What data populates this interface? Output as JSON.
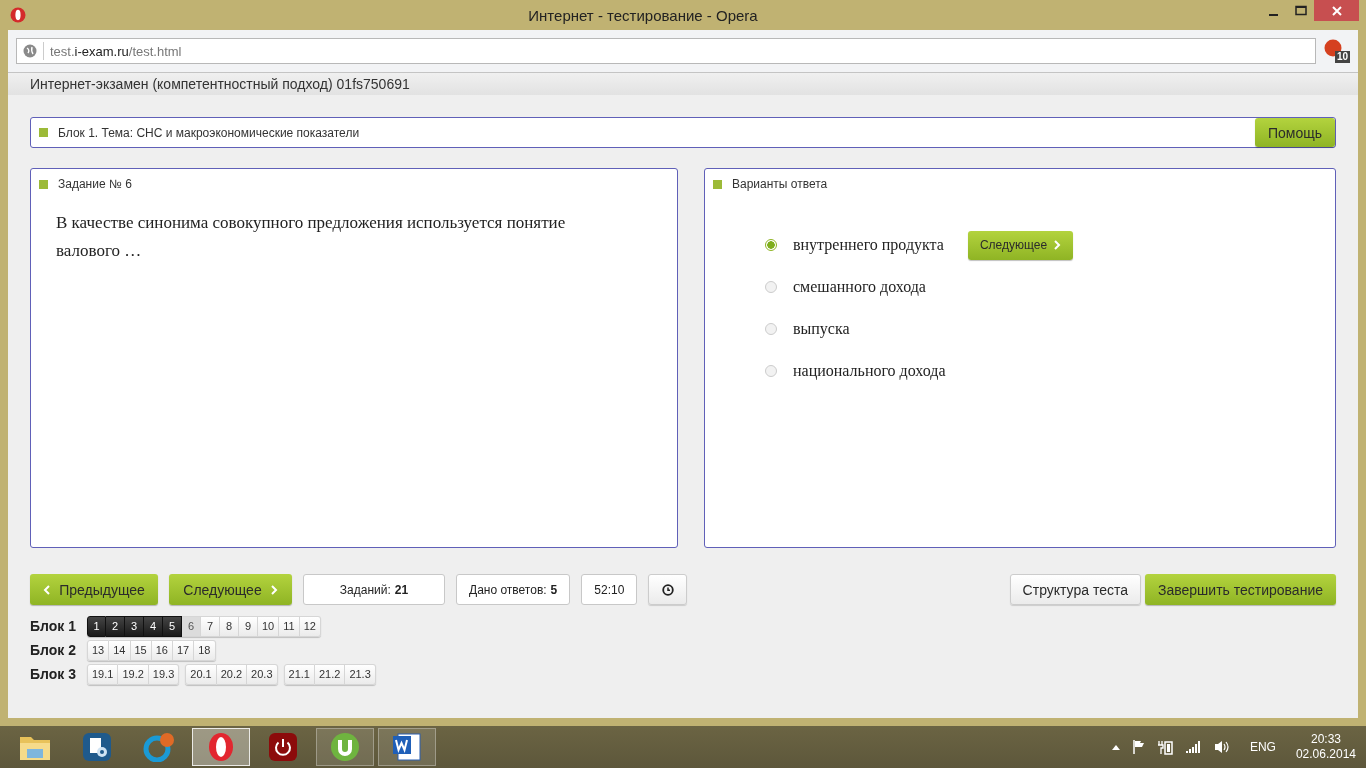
{
  "window": {
    "title": "Интернет - тестирование - Opera"
  },
  "address_bar": {
    "url": {
      "subdomain": "test.",
      "domain": "i-exam.ru",
      "path": "/test.html"
    },
    "extension_badge": "10"
  },
  "page_header": {
    "title": "Интернет-экзамен (компетентностный подход) 01fs750691"
  },
  "block_bar": {
    "title": "Блок 1. Тема: СНС и макроэкономические показатели",
    "help_button": "Помощь"
  },
  "task_panel": {
    "title": "Задание № 6",
    "question": "В качестве синонима совокупного предложения используется понятие валового …"
  },
  "answers_panel": {
    "title": "Варианты ответа",
    "next_button": "Следующее",
    "options": [
      {
        "label": "внутреннего продукта",
        "selected": true
      },
      {
        "label": "смешанного дохода",
        "selected": false
      },
      {
        "label": "выпуска",
        "selected": false
      },
      {
        "label": "национального дохода",
        "selected": false
      }
    ]
  },
  "nav": {
    "prev_button": "Предыдущее",
    "next_button": "Следующее",
    "counters": [
      {
        "label": "Заданий:",
        "value": "21"
      },
      {
        "label": "Дано ответов:",
        "value": "5"
      }
    ],
    "timer": "52:10",
    "structure_button": "Структура теста",
    "finish_button": "Завершить тестирование"
  },
  "blocks": [
    {
      "name": "Блок 1",
      "groups": [
        [
          {
            "label": "1",
            "answered": true,
            "selected": false
          },
          {
            "label": "2",
            "answered": true,
            "selected": false
          },
          {
            "label": "3",
            "answered": true,
            "selected": false
          },
          {
            "label": "4",
            "answered": true,
            "selected": false
          },
          {
            "label": "5",
            "answered": true,
            "selected": false
          },
          {
            "label": "6",
            "answered": false,
            "selected": true
          },
          {
            "label": "7",
            "answered": false,
            "selected": false
          },
          {
            "label": "8",
            "answered": false,
            "selected": false
          },
          {
            "label": "9",
            "answered": false,
            "selected": false
          },
          {
            "label": "10",
            "answered": false,
            "selected": false
          },
          {
            "label": "11",
            "answered": false,
            "selected": false
          },
          {
            "label": "12",
            "answered": false,
            "selected": false
          }
        ]
      ]
    },
    {
      "name": "Блок 2",
      "groups": [
        [
          {
            "label": "13",
            "answered": false,
            "selected": false
          },
          {
            "label": "14",
            "answered": false,
            "selected": false
          },
          {
            "label": "15",
            "answered": false,
            "selected": false
          },
          {
            "label": "16",
            "answered": false,
            "selected": false
          },
          {
            "label": "17",
            "answered": false,
            "selected": false
          },
          {
            "label": "18",
            "answered": false,
            "selected": false
          }
        ]
      ]
    },
    {
      "name": "Блок 3",
      "groups": [
        [
          {
            "label": "19.1",
            "answered": false,
            "selected": false
          },
          {
            "label": "19.2",
            "answered": false,
            "selected": false
          },
          {
            "label": "19.3",
            "answered": false,
            "selected": false
          }
        ],
        [
          {
            "label": "20.1",
            "answered": false,
            "selected": false
          },
          {
            "label": "20.2",
            "answered": false,
            "selected": false
          },
          {
            "label": "20.3",
            "answered": false,
            "selected": false
          }
        ],
        [
          {
            "label": "21.1",
            "answered": false,
            "selected": false
          },
          {
            "label": "21.2",
            "answered": false,
            "selected": false
          },
          {
            "label": "21.3",
            "answered": false,
            "selected": false
          }
        ]
      ]
    }
  ],
  "taskbar": {
    "apps": [
      {
        "kind": "folder",
        "running": false,
        "selected": false
      },
      {
        "kind": "settings",
        "running": false,
        "selected": false
      },
      {
        "kind": "cleaner",
        "running": false,
        "selected": false
      },
      {
        "kind": "opera",
        "running": true,
        "selected": true
      },
      {
        "kind": "power",
        "running": false,
        "selected": false
      },
      {
        "kind": "torrent",
        "running": true,
        "selected": false
      },
      {
        "kind": "word",
        "running": true,
        "selected": false
      }
    ],
    "language": "ENG",
    "time": "20:33",
    "date": "02.06.2014"
  }
}
